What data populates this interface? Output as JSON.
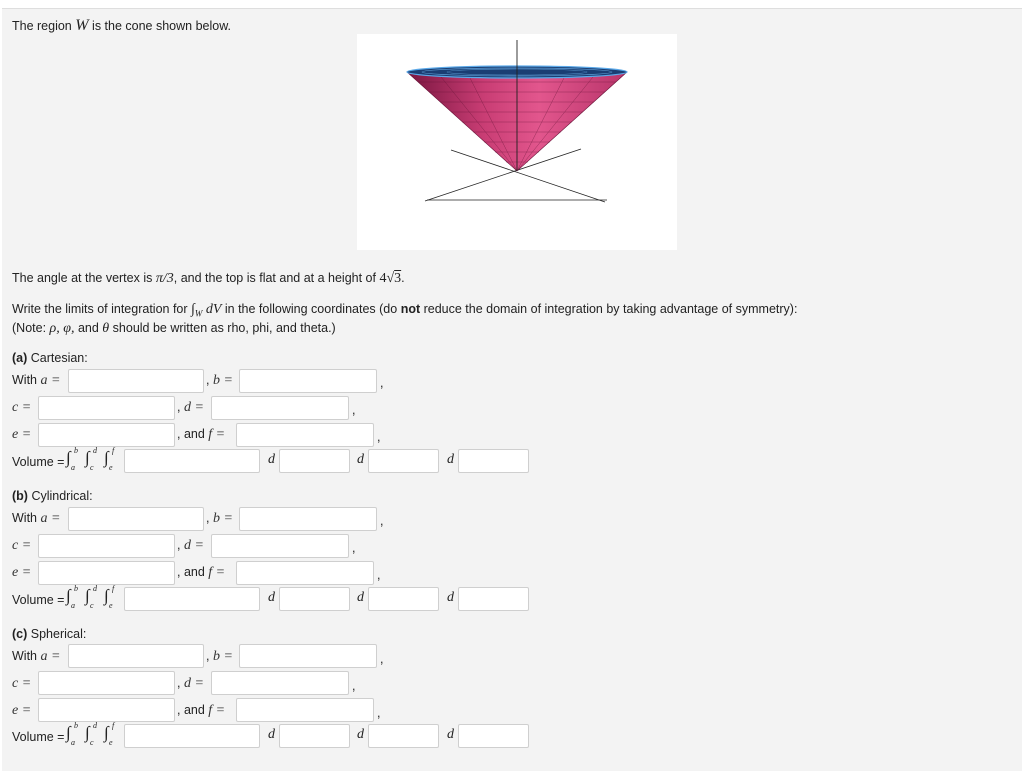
{
  "intro": {
    "text_before": "The region ",
    "region_var": "W",
    "text_after": " is the cone shown below."
  },
  "angle_line": {
    "pre": "The angle at the vertex is ",
    "angle": "π/3",
    "mid": ", and the top is flat and at a height of ",
    "height_coef": "4",
    "height_rad": "3",
    "post": "."
  },
  "instructions": {
    "pre": "Write the limits of integration for ",
    "int_sym": "∫",
    "int_sub": "W",
    "dv": "dV",
    "mid": " in the following coordinates (do ",
    "bold": "not",
    "post": " reduce the domain of integration by taking advantage of symmetry):"
  },
  "note": {
    "pre": "(Note: ",
    "vars": "ρ, φ,",
    "and": " and ",
    "theta": "θ",
    "post": " should be written as rho, phi, and theta.)"
  },
  "labels": {
    "with": "With ",
    "a_eq": "a =",
    "b_eq": "b =",
    "c_eq": "c =",
    "d_eq": "d =",
    "e_eq": "e =",
    "and": ", and ",
    "f_eq": "f =",
    "comma": ",",
    "volume": "Volume = ",
    "d": "d",
    "int": "∫",
    "lim_a": "a",
    "lim_b": "b",
    "lim_c": "c",
    "lim_d": "d",
    "lim_e": "e",
    "lim_f": "f"
  },
  "sections": [
    {
      "letter": "(a)",
      "name": " Cartesian:"
    },
    {
      "letter": "(b)",
      "name": " Cylindrical:"
    },
    {
      "letter": "(c)",
      "name": " Spherical:"
    }
  ],
  "fields": {
    "a": [
      "",
      "",
      ""
    ],
    "b": [
      "",
      "",
      ""
    ],
    "c": [
      "",
      "",
      ""
    ],
    "d": [
      "",
      "",
      ""
    ],
    "e": [
      "",
      "",
      ""
    ],
    "f": [
      "",
      "",
      ""
    ],
    "integrand": [
      "",
      "",
      ""
    ],
    "d1": [
      "",
      "",
      ""
    ],
    "d2": [
      "",
      "",
      ""
    ],
    "d3": [
      "",
      "",
      ""
    ]
  },
  "figure": {
    "colors": {
      "cone_dark": "#8b1a44",
      "cone_mid": "#d2477a",
      "cone_light": "#e0528a",
      "top_edge": "#5aa8e8",
      "axis": "#222222"
    }
  }
}
